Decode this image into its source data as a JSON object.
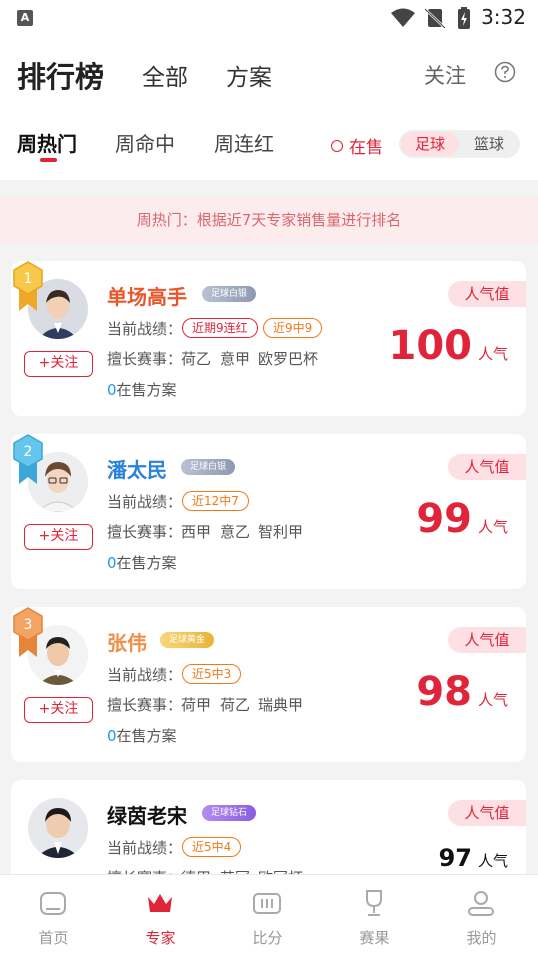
{
  "status_bar": {
    "time": "3:32",
    "app_badge": "A"
  },
  "header": {
    "title": "排行榜",
    "top_tabs": [
      "全部",
      "方案"
    ],
    "follow_link": "关注",
    "sub_tabs": [
      "周热门",
      "周命中",
      "周连红"
    ],
    "active_sub_tab": "周热门",
    "onsale_filter": "在售",
    "sport_options": [
      "足球",
      "篮球"
    ],
    "selected_sport": "足球"
  },
  "notice": "周热门：根据近7天专家销售量进行排名",
  "colors": {
    "accent": "#e0243a",
    "rank1_name": "#e8562a",
    "rank2_name": "#2b82d9",
    "rank3_name": "#f08f4a",
    "onsale_count": "#2196f3"
  },
  "experts": [
    {
      "rank": "1",
      "name": "单场高手",
      "level": "足球白银",
      "record_label": "当前战绩：",
      "records": [
        "近期9连红",
        "近9中9"
      ],
      "specialty_label": "擅长赛事：",
      "specialties": [
        "荷乙",
        "意甲",
        "欧罗巴杯"
      ],
      "onsale_count": "0",
      "onsale_text": "在售方案",
      "popularity_label": "人气值",
      "popularity": "100",
      "popularity_unit": "人气",
      "follow": "+关注"
    },
    {
      "rank": "2",
      "name": "潘太民",
      "level": "足球白银",
      "record_label": "当前战绩：",
      "records": [
        "近12中7"
      ],
      "specialty_label": "擅长赛事：",
      "specialties": [
        "西甲",
        "意乙",
        "智利甲"
      ],
      "onsale_count": "0",
      "onsale_text": "在售方案",
      "popularity_label": "人气值",
      "popularity": "99",
      "popularity_unit": "人气",
      "follow": "+关注"
    },
    {
      "rank": "3",
      "name": "张伟",
      "level": "足球黄金",
      "record_label": "当前战绩：",
      "records": [
        "近5中3"
      ],
      "specialty_label": "擅长赛事：",
      "specialties": [
        "荷甲",
        "荷乙",
        "瑞典甲"
      ],
      "onsale_count": "0",
      "onsale_text": "在售方案",
      "popularity_label": "人气值",
      "popularity": "98",
      "popularity_unit": "人气",
      "follow": "+关注"
    },
    {
      "rank": "",
      "name": "绿茵老宋",
      "level": "足球钻石",
      "record_label": "当前战绩：",
      "records": [
        "近5中4"
      ],
      "specialty_label": "擅长赛事：",
      "specialties": [
        "德甲",
        "英冠",
        "欧冠杯"
      ],
      "onsale_count": "",
      "onsale_text": "",
      "popularity_label": "人气值",
      "popularity": "97",
      "popularity_unit": "人气",
      "follow": ""
    }
  ],
  "bottom_nav": [
    {
      "label": "首页",
      "icon": "home-icon"
    },
    {
      "label": "专家",
      "icon": "crown-icon"
    },
    {
      "label": "比分",
      "icon": "scoreboard-icon"
    },
    {
      "label": "赛果",
      "icon": "trophy-icon"
    },
    {
      "label": "我的",
      "icon": "profile-icon"
    }
  ],
  "active_nav": "专家"
}
